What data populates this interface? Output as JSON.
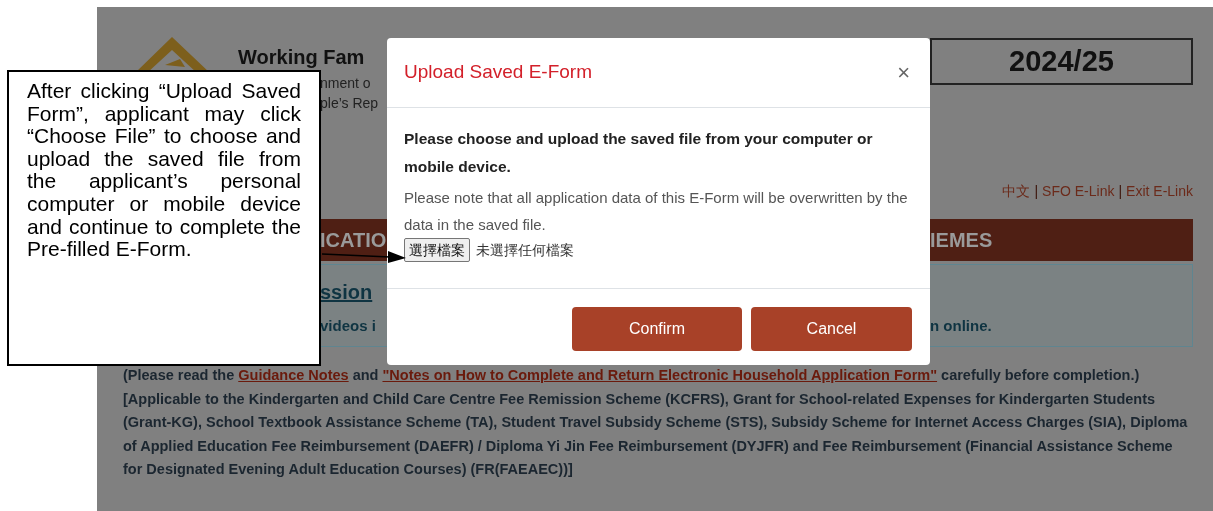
{
  "page": {
    "header": {
      "title_fragment": "Working Fam",
      "subtitle_fragments": [
        "nment o",
        "ple’s Rep"
      ],
      "year": "2024/25"
    },
    "top_links": [
      {
        "kind": "link",
        "text": "中文"
      },
      {
        "kind": "separator",
        "text": "|"
      },
      {
        "kind": "link",
        "text": "SFO E-Link"
      },
      {
        "kind": "separator",
        "text": "|"
      },
      {
        "kind": "link",
        "text": "Exit E-Link"
      }
    ],
    "section_bar": {
      "fragments": [
        "ICATIO",
        "IEMES"
      ]
    },
    "info_box": {
      "heading_fragment": "ssion",
      "line_fragments": [
        "videos i",
        "n online."
      ]
    },
    "paragraphs": [
      [
        {
          "kind": "text",
          "text": "(Please read the "
        },
        {
          "kind": "link",
          "text": "Guidance Notes"
        },
        {
          "kind": "text",
          "text": " and "
        },
        {
          "kind": "link",
          "text": "\"Notes on How to Complete and Return Electronic Household Application Form\""
        },
        {
          "kind": "text",
          "text": " carefully before completion.)"
        }
      ],
      [
        {
          "kind": "text",
          "text": "[Applicable to the Kindergarten and Child Care Centre Fee Remission Scheme (KCFRS), Grant for School-related Expenses for Kindergarten Students (Grant-KG), School Textbook Assistance Scheme (TA), Student Travel Subsidy Scheme (STS), Subsidy Scheme for Internet Access Charges (SIA), Diploma of Applied Education Fee Reimbursement (DAEFR) / Diploma Yi Jin Fee Reimbursement (DYJFR) and Fee Reimbursement (Financial Assistance Scheme for Designated Evening Adult Education Courses) (FR(FAEAEC))]"
        }
      ]
    ]
  },
  "modal": {
    "title": "Upload Saved E-Form",
    "close": "×",
    "lead": "Please choose and upload the saved file from your computer or mobile device.",
    "note": "Please note that all application data of this E-Form will be overwritten by the data in the saved file.",
    "file_button": "選擇檔案",
    "file_status": "未選擇任何檔案",
    "buttons": [
      {
        "label": "Confirm"
      },
      {
        "label": "Cancel"
      }
    ]
  },
  "callout": {
    "text": "After clicking “Upload Saved Form”, applicant may click “Choose File” to choose and upload the saved file from the applicant’s personal computer or mobile device and continue to complete the Pre-filled E-Form."
  }
}
